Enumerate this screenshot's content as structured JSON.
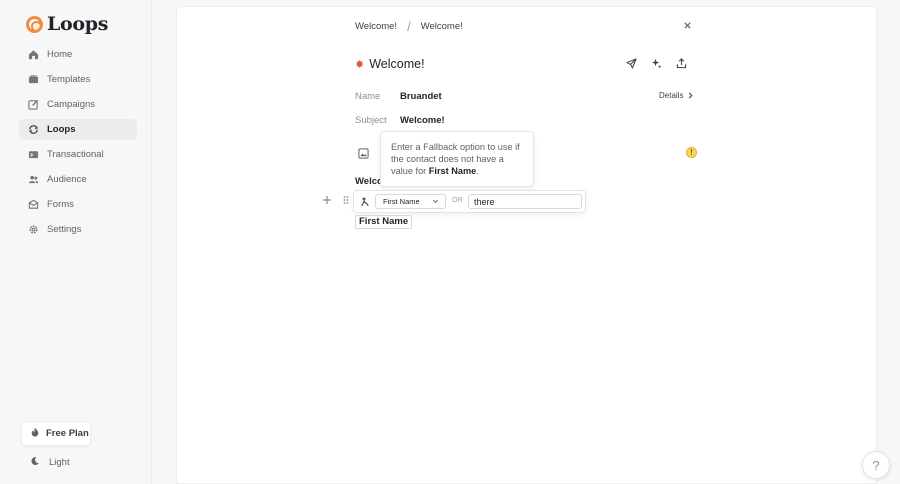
{
  "app": {
    "logo_text": "Loops"
  },
  "sidebar": {
    "items": [
      {
        "label": "Home",
        "icon": "home-icon",
        "active": false
      },
      {
        "label": "Templates",
        "icon": "templates-icon",
        "active": false
      },
      {
        "label": "Campaigns",
        "icon": "campaigns-icon",
        "active": false
      },
      {
        "label": "Loops",
        "icon": "loops-icon",
        "active": true
      },
      {
        "label": "Transactional",
        "icon": "transactional-icon",
        "active": false
      },
      {
        "label": "Audience",
        "icon": "audience-icon",
        "active": false
      },
      {
        "label": "Forms",
        "icon": "forms-icon",
        "active": false
      },
      {
        "label": "Settings",
        "icon": "settings-icon",
        "active": false
      }
    ],
    "plan_label": "Free Plan",
    "theme_label": "Light"
  },
  "breadcrumb": {
    "first": "Welcome!",
    "second": "Welcome!"
  },
  "email": {
    "title": "Welcome!",
    "name_label": "Name",
    "name_value": "Bruandet",
    "subject_label": "Subject",
    "subject_value": "Welcome!",
    "details_label": "Details",
    "body_line": "Welco"
  },
  "tooltip": {
    "text": "Enter a Fallback option to use if the contact does not have a value for ",
    "bold": "First Name",
    "suffix": "."
  },
  "fallback": {
    "selected": "First Name",
    "or_label": "OR",
    "value": "there"
  },
  "merge_tag": "First Name",
  "help_label": "?",
  "colors": {
    "brand": "#f28b3c",
    "warning": "#fbd45a"
  }
}
